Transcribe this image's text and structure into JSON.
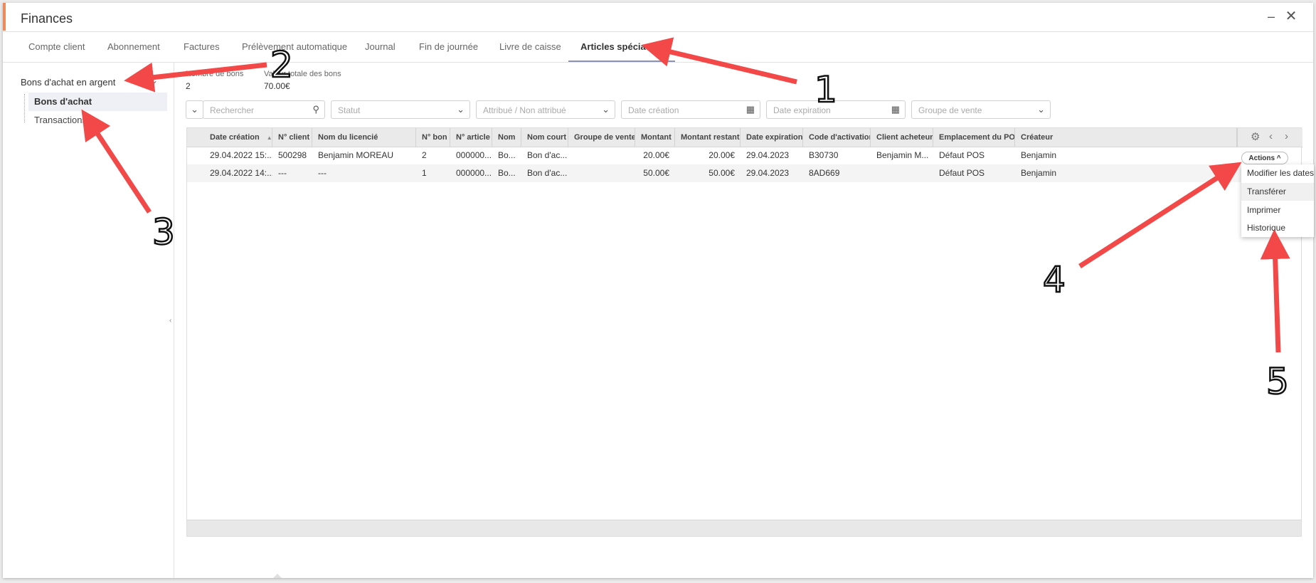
{
  "window": {
    "title": "Finances"
  },
  "tabs": [
    {
      "label": "Compte client"
    },
    {
      "label": "Abonnement"
    },
    {
      "label": "Factures"
    },
    {
      "label": "Prélèvement automatique"
    },
    {
      "label": "Journal"
    },
    {
      "label": "Fin de journée"
    },
    {
      "label": "Livre de caisse"
    },
    {
      "label": "Articles spéciaux",
      "active": true
    }
  ],
  "sidebar": {
    "group": "Bons d'achat en argent",
    "items": [
      {
        "label": "Bons d'achat",
        "active": true
      },
      {
        "label": "Transactions"
      }
    ]
  },
  "stats": {
    "count_label": "Nombre de bons",
    "count_value": "2",
    "total_label": "Valeur totale des bons",
    "total_value": "70.00€"
  },
  "filters": {
    "search_placeholder": "Rechercher",
    "status_placeholder": "Statut",
    "assigned_placeholder": "Attribué / Non attribué",
    "created_placeholder": "Date création",
    "expiration_placeholder": "Date expiration",
    "sales_group_placeholder": "Groupe de vente"
  },
  "table": {
    "columns": [
      "Date création",
      "N° client",
      "Nom du licencié",
      "N° bon",
      "N° article",
      "Nom",
      "Nom court",
      "Groupe de vente",
      "Montant",
      "Montant restant",
      "Date expiration",
      "Code d'activation",
      "Client acheteur",
      "Emplacement du POS",
      "Créateur"
    ],
    "rows": [
      [
        "29.04.2022 15:...",
        "500298",
        "Benjamin MOREAU",
        "2",
        "000000...",
        "Bo...",
        "Bon d'ac...",
        "",
        "20.00€",
        "20.00€",
        "29.04.2023",
        "B30730",
        "Benjamin M...",
        "Défaut POS",
        "Benjamin"
      ],
      [
        "29.04.2022 14:...",
        "---",
        "---",
        "1",
        "000000...",
        "Bo...",
        "Bon d'ac...",
        "",
        "50.00€",
        "50.00€",
        "29.04.2023",
        "8AD669",
        "",
        "Défaut POS",
        "Benjamin"
      ]
    ]
  },
  "actions": {
    "button_label": "Actions",
    "menu": [
      "Modifier les dates",
      "Transférer",
      "Imprimer",
      "Historique"
    ]
  },
  "annotations": [
    "1",
    "2",
    "3",
    "4",
    "5"
  ],
  "colors": {
    "accent": "#f08a5d",
    "arrow": "#f24848",
    "active_tab_underline": "#8c93b4"
  }
}
